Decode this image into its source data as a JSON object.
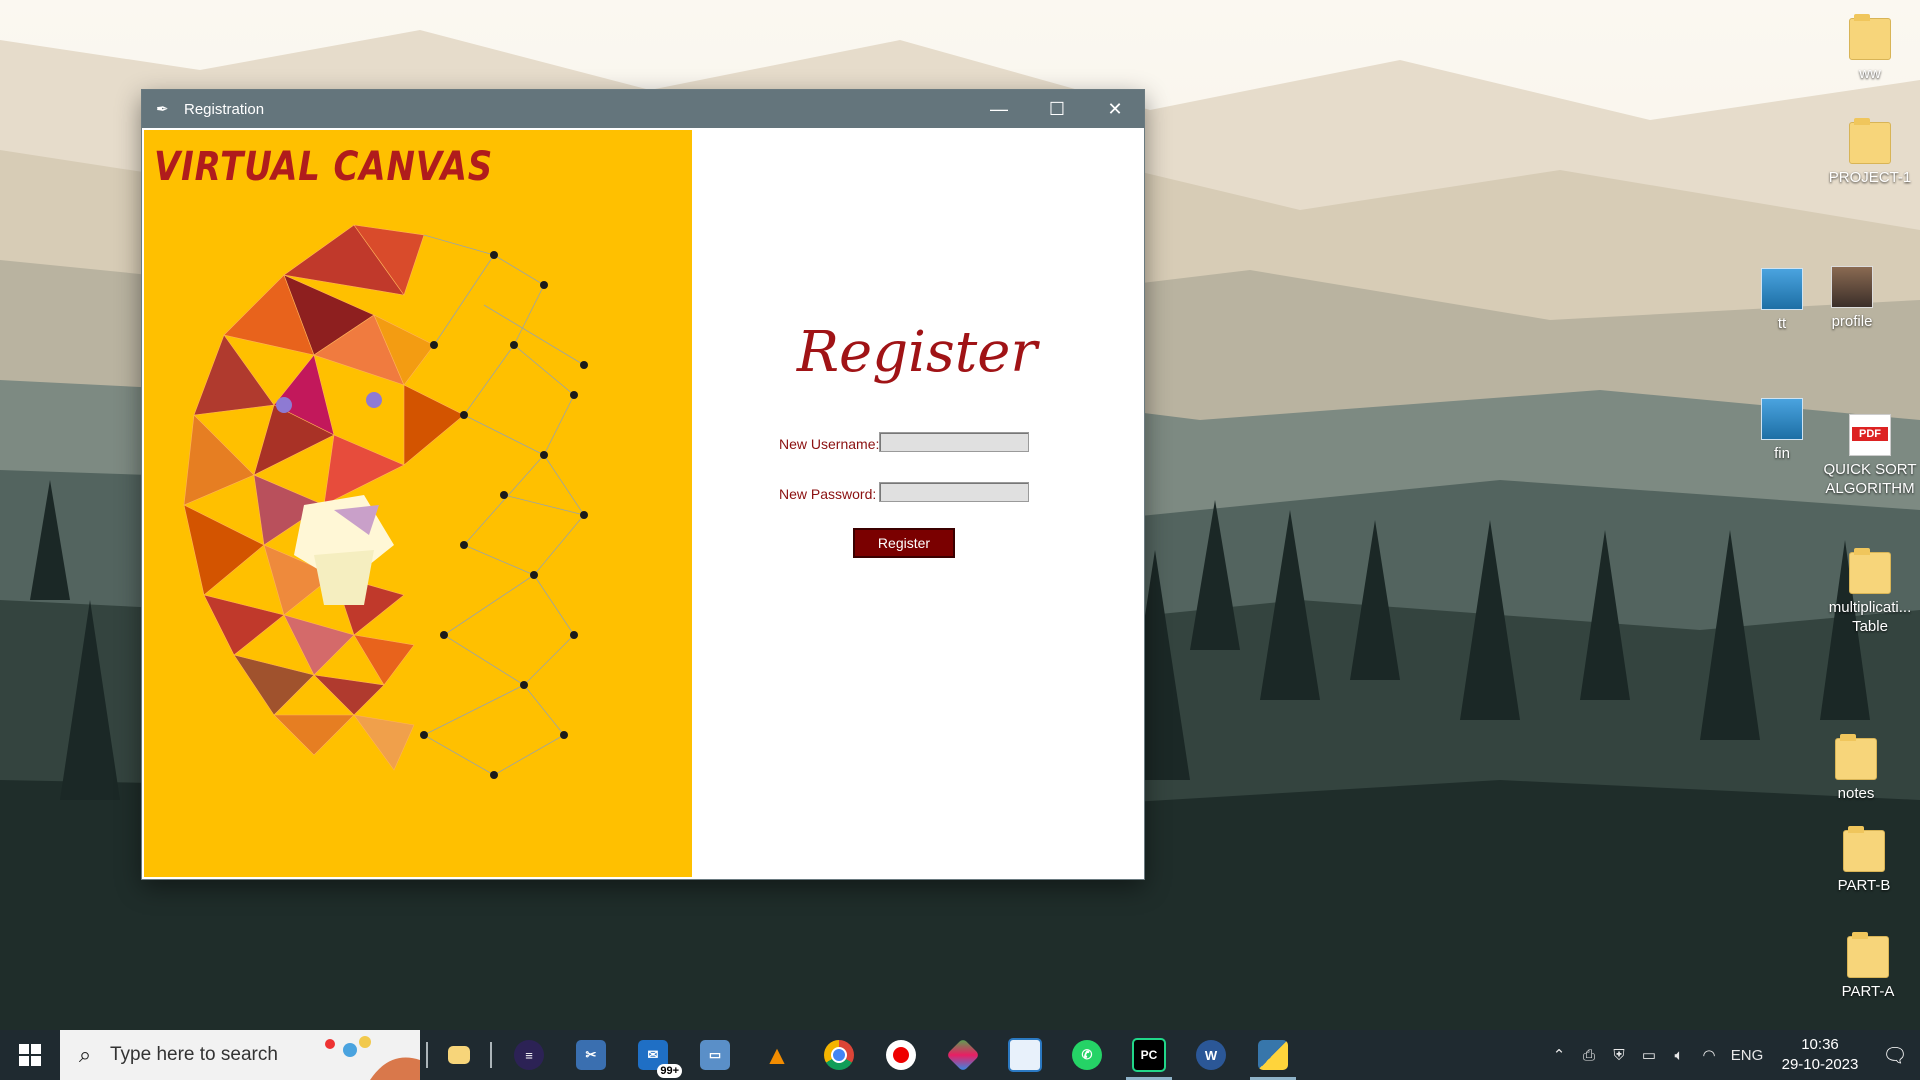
{
  "desktop": {
    "icons": [
      {
        "label": "ww",
        "type": "folder"
      },
      {
        "label": "PROJECT-1",
        "type": "folder"
      },
      {
        "label": "tt",
        "type": "image"
      },
      {
        "label": "profile",
        "type": "photo"
      },
      {
        "label": "fin",
        "type": "image"
      },
      {
        "label": "QUICK SORT ALGORITHM",
        "type": "pdf",
        "badge": "PDF"
      },
      {
        "label": "multiplicati... Table",
        "type": "folder"
      },
      {
        "label": "notes",
        "type": "folder"
      },
      {
        "label": "PART-B",
        "type": "folder"
      },
      {
        "label": "PART-A",
        "type": "folder"
      }
    ]
  },
  "window": {
    "title": "Registration",
    "icon": "feather-icon",
    "controls": {
      "minimize": "—",
      "maximize": "☐",
      "close": "✕"
    },
    "left_panel": {
      "brand": "VIRTUAL CANVAS",
      "bg_color": "#ffc000"
    },
    "form": {
      "heading": "Register",
      "username_label": "New Username:",
      "username_value": "",
      "password_label": "New Password:",
      "password_value": "",
      "button_label": "Register",
      "accent_color": "#7a0000"
    }
  },
  "taskbar": {
    "search_placeholder": "Type here to search",
    "mail_badge": "99+",
    "apps": [
      {
        "name": "eclipse-icon"
      },
      {
        "name": "snipping-tool-icon"
      },
      {
        "name": "mail-icon"
      },
      {
        "name": "laptop-icon"
      },
      {
        "name": "vlc-icon"
      },
      {
        "name": "chrome-icon"
      },
      {
        "name": "record-icon"
      },
      {
        "name": "git-icon"
      },
      {
        "name": "notepad-icon"
      },
      {
        "name": "whatsapp-icon"
      },
      {
        "name": "pycharm-icon",
        "label": "PC"
      },
      {
        "name": "word-icon"
      },
      {
        "name": "python-icon"
      }
    ],
    "tray": {
      "language": "ENG",
      "time": "10:36",
      "date": "29-10-2023"
    }
  }
}
